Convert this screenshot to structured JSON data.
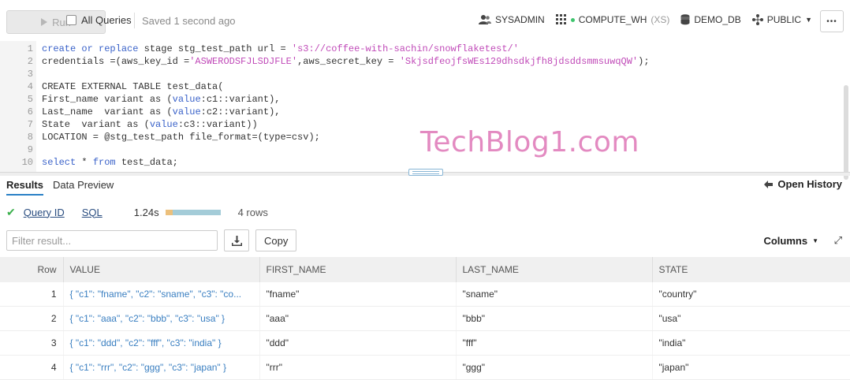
{
  "toolbar": {
    "run_label": "Run",
    "all_queries_label": "All Queries",
    "saved_status": "Saved 1 second ago",
    "role": "SYSADMIN",
    "warehouse": "COMPUTE_WH",
    "warehouse_size": "(XS)",
    "database": "DEMO_DB",
    "schema": "PUBLIC",
    "more": "•••"
  },
  "editor": {
    "lines": [
      {
        "n": "1",
        "code": "create or replace stage stg_test_path url = 's3://coffee-with-sachin/snowflaketest/'"
      },
      {
        "n": "2",
        "code": "credentials =(aws_key_id ='ASWERODSFJLSDJFLE',aws_secret_key = 'SkjsdfeojfsWEs129dhsdkjfh8jdsddsmmsuwqQW');"
      },
      {
        "n": "3",
        "code": ""
      },
      {
        "n": "4",
        "code": "CREATE EXTERNAL TABLE test_data("
      },
      {
        "n": "5",
        "code": "First_name variant as (value:c1::variant),"
      },
      {
        "n": "6",
        "code": "Last_name  variant as (value:c2::variant),"
      },
      {
        "n": "7",
        "code": "State  variant as (value:c3::variant))"
      },
      {
        "n": "8",
        "code": "LOCATION = @stg_test_path file_format=(type=csv);"
      },
      {
        "n": "9",
        "code": ""
      },
      {
        "n": "10",
        "code": "select * from test_data;"
      }
    ]
  },
  "watermark": "TechBlog1.com",
  "results": {
    "tabs": [
      "Results",
      "Data Preview"
    ],
    "open_history": "Open History",
    "query_id": "Query ID",
    "sql": "SQL",
    "duration": "1.24s",
    "progress_queued_fraction": 0.14,
    "row_count": "4 rows",
    "filter_placeholder": "Filter result...",
    "copy_label": "Copy",
    "columns_label": "Columns",
    "headers": [
      "Row",
      "VALUE",
      "FIRST_NAME",
      "LAST_NAME",
      "STATE"
    ],
    "rows": [
      [
        "1",
        "{ \"c1\": \"fname\", \"c2\": \"sname\", \"c3\": \"co...",
        "\"fname\"",
        "\"sname\"",
        "\"country\""
      ],
      [
        "2",
        "{ \"c1\": \"aaa\", \"c2\": \"bbb\", \"c3\": \"usa\" }",
        "\"aaa\"",
        "\"bbb\"",
        "\"usa\""
      ],
      [
        "3",
        "{ \"c1\": \"ddd\", \"c2\": \"fff\", \"c3\": \"india\" }",
        "\"ddd\"",
        "\"fff\"",
        "\"india\""
      ],
      [
        "4",
        "{ \"c1\": \"rrr\", \"c2\": \"ggg\", \"c3\": \"japan\" }",
        "\"rrr\"",
        "\"ggg\"",
        "\"japan\""
      ]
    ]
  }
}
